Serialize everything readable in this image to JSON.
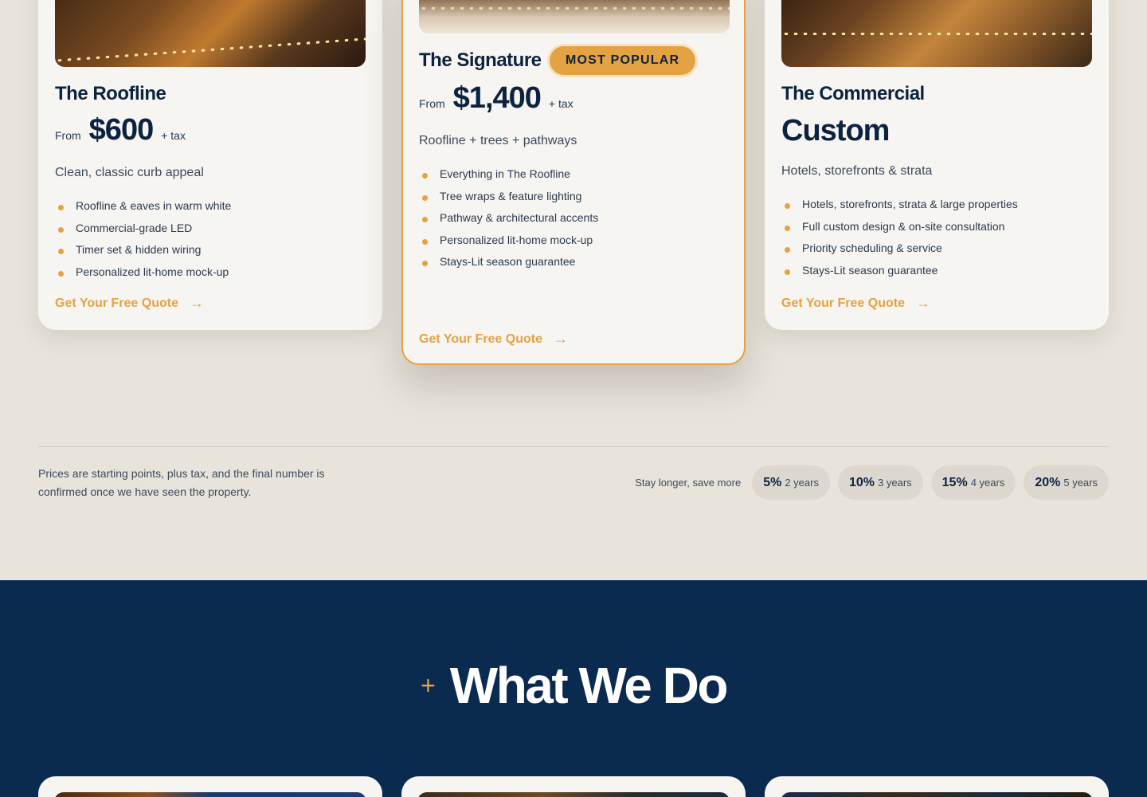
{
  "pricing": {
    "cards": [
      {
        "name": "The Roofline",
        "from_label": "From",
        "price": "$600",
        "tax_label": "+ tax",
        "tagline": "Clean, classic curb appeal",
        "features": [
          "Roofline & eaves in warm white",
          "Commercial-grade LED",
          "Timer set & hidden wiring",
          "Personalized lit-home mock-up"
        ],
        "cta": "Get Your Free Quote"
      },
      {
        "name": "The Signature",
        "badge": "MOST POPULAR",
        "from_label": "From",
        "price": "$1,400",
        "tax_label": "+ tax",
        "tagline": "Roofline + trees + pathways",
        "features": [
          "Everything in The Roofline",
          "Tree wraps & feature lighting",
          "Pathway & architectural accents",
          "Personalized lit-home mock-up",
          "Stays-Lit season guarantee"
        ],
        "cta": "Get Your Free Quote"
      },
      {
        "name": "The Commercial",
        "price": "Custom",
        "tagline": "Hotels, storefronts & strata",
        "features": [
          "Hotels, storefronts, strata & large properties",
          "Full custom design & on-site consultation",
          "Priority scheduling & service",
          "Stays-Lit season guarantee"
        ],
        "cta": "Get Your Free Quote"
      }
    ],
    "cta_arrow": "→",
    "note": "Prices are starting points, plus tax, and the final number is confirmed once we have seen the property.",
    "discounts_label": "Stay longer, save more",
    "discounts": [
      {
        "pct": "5%",
        "years": "2 years"
      },
      {
        "pct": "10%",
        "years": "3 years"
      },
      {
        "pct": "15%",
        "years": "4 years"
      },
      {
        "pct": "20%",
        "years": "5 years"
      }
    ]
  },
  "services": {
    "plus": "+",
    "title": "What We Do"
  },
  "colors": {
    "accent": "#e4a242",
    "navy": "#0c2340",
    "dark_section": "#0a2a50",
    "page_bg": "#e8e4db",
    "card_bg": "#f7f5f1"
  },
  "icons": {
    "feature_bullet": "dot-icon",
    "cta_arrow": "arrow-right-icon"
  }
}
